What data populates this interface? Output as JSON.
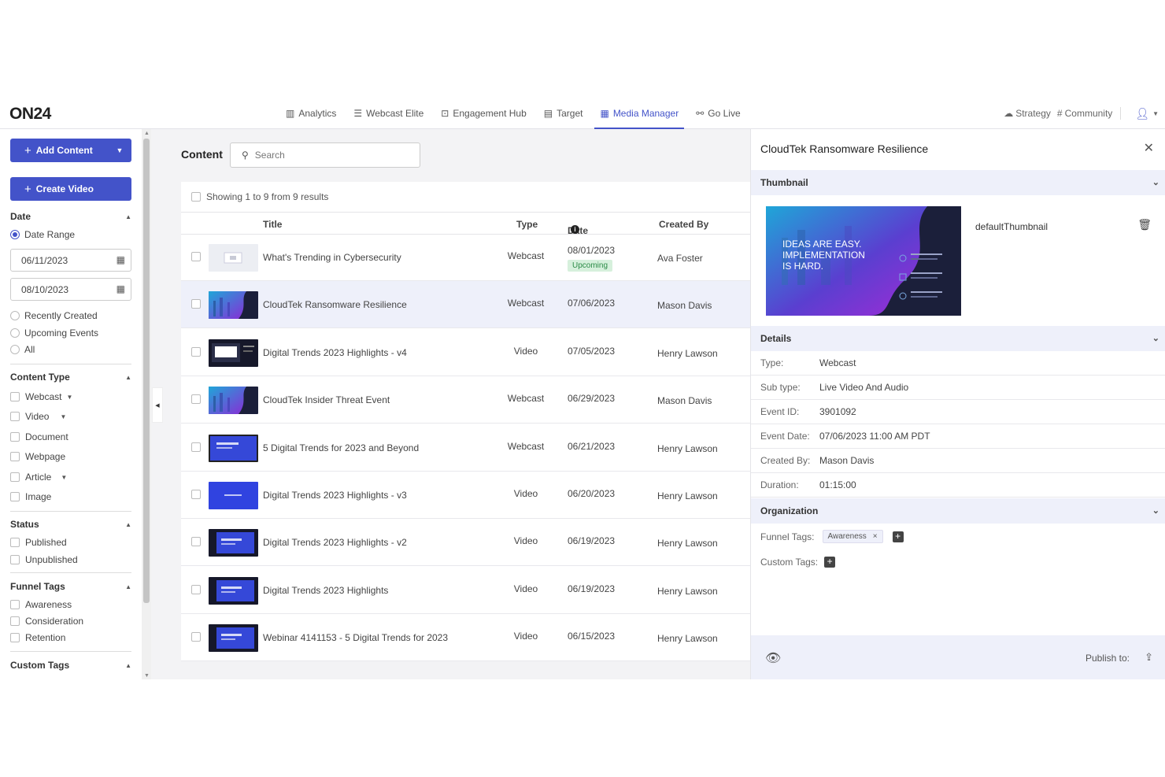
{
  "brand": {
    "logo": "ON24",
    "accent": "#4353c9"
  },
  "nav": {
    "items": [
      {
        "label": "Analytics",
        "icon": "bar-chart-icon",
        "glyph": "▥",
        "active": false
      },
      {
        "label": "Webcast Elite",
        "icon": "list-icon",
        "glyph": "☰",
        "active": false
      },
      {
        "label": "Engagement Hub",
        "icon": "hub-icon",
        "glyph": "⊡",
        "active": false
      },
      {
        "label": "Target",
        "icon": "target-icon",
        "glyph": "▤",
        "active": false
      },
      {
        "label": "Media Manager",
        "icon": "grid-icon",
        "glyph": "▦",
        "active": true
      },
      {
        "label": "Go Live",
        "icon": "go-live-icon",
        "glyph": "⚯",
        "active": false
      }
    ],
    "strategy": "Strategy",
    "community": "Community"
  },
  "sidebar": {
    "add_content": "Add Content",
    "create_video": "Create Video",
    "date": {
      "heading": "Date",
      "range_label": "Date Range",
      "from": "06/11/2023",
      "to": "08/10/2023",
      "options": [
        "Recently Created",
        "Upcoming Events",
        "All"
      ]
    },
    "content_type": {
      "heading": "Content Type",
      "options": [
        "Webcast",
        "Video",
        "Document",
        "Webpage",
        "Article",
        "Image"
      ]
    },
    "status": {
      "heading": "Status",
      "options": [
        "Published",
        "Unpublished"
      ]
    },
    "funnel_tags": {
      "heading": "Funnel Tags",
      "options": [
        "Awareness",
        "Consideration",
        "Retention"
      ]
    },
    "custom_tags": {
      "heading": "Custom Tags"
    }
  },
  "main": {
    "title": "Content",
    "search_placeholder": "Search",
    "showing": "Showing 1 to 9 from 9 results",
    "columns": {
      "title": "Title",
      "type": "Type",
      "date": "Date",
      "created_by": "Created By"
    },
    "rows": [
      {
        "title": "What's Trending in Cybersecurity",
        "type": "Webcast",
        "date": "08/01/2023",
        "badge": "Upcoming",
        "creator": "Ava Foster",
        "thumb": "gray"
      },
      {
        "title": "CloudTek Ransomware Resilience",
        "type": "Webcast",
        "date": "07/06/2023",
        "badge": "",
        "creator": "Mason Davis",
        "thumb": "city",
        "selected": true
      },
      {
        "title": "Digital Trends 2023 Highlights - v4",
        "type": "Video",
        "date": "07/05/2023",
        "badge": "",
        "creator": "Henry Lawson",
        "thumb": "dark"
      },
      {
        "title": "CloudTek Insider Threat Event",
        "type": "Webcast",
        "date": "06/29/2023",
        "badge": "",
        "creator": "Mason Davis",
        "thumb": "city"
      },
      {
        "title": "5 Digital Trends for 2023 and Beyond",
        "type": "Webcast",
        "date": "06/21/2023",
        "badge": "",
        "creator": "Henry Lawson",
        "thumb": "blue-framed"
      },
      {
        "title": "Digital Trends 2023 Highlights - v3",
        "type": "Video",
        "date": "06/20/2023",
        "badge": "",
        "creator": "Henry Lawson",
        "thumb": "blue"
      },
      {
        "title": "Digital Trends 2023 Highlights - v2",
        "type": "Video",
        "date": "06/19/2023",
        "badge": "",
        "creator": "Henry Lawson",
        "thumb": "blue-dark"
      },
      {
        "title": "Digital Trends 2023 Highlights",
        "type": "Video",
        "date": "06/19/2023",
        "badge": "",
        "creator": "Henry Lawson",
        "thumb": "blue-dark"
      },
      {
        "title": "Webinar 4141153 - 5 Digital Trends for 2023",
        "type": "Video",
        "date": "06/15/2023",
        "badge": "",
        "creator": "Henry Lawson",
        "thumb": "blue-dark"
      }
    ]
  },
  "panel": {
    "title": "CloudTek Ransomware Resilience",
    "thumbnail_heading": "Thumbnail",
    "thumbnail_name": "defaultThumbnail",
    "thumbnail_text": "IDEAS ARE EASY. IMPLEMENTATION IS HARD.",
    "details_heading": "Details",
    "details": [
      {
        "label": "Type:",
        "value": "Webcast"
      },
      {
        "label": "Sub type:",
        "value": "Live Video And Audio"
      },
      {
        "label": "Event ID:",
        "value": "3901092"
      },
      {
        "label": "Event Date:",
        "value": "07/06/2023 11:00 AM PDT"
      },
      {
        "label": "Created By:",
        "value": "Mason Davis"
      },
      {
        "label": "Duration:",
        "value": "01:15:00"
      }
    ],
    "organization_heading": "Organization",
    "funnel_tags_label": "Funnel Tags:",
    "funnel_tag": "Awareness",
    "custom_tags_label": "Custom Tags:",
    "publish_label": "Publish to:"
  }
}
